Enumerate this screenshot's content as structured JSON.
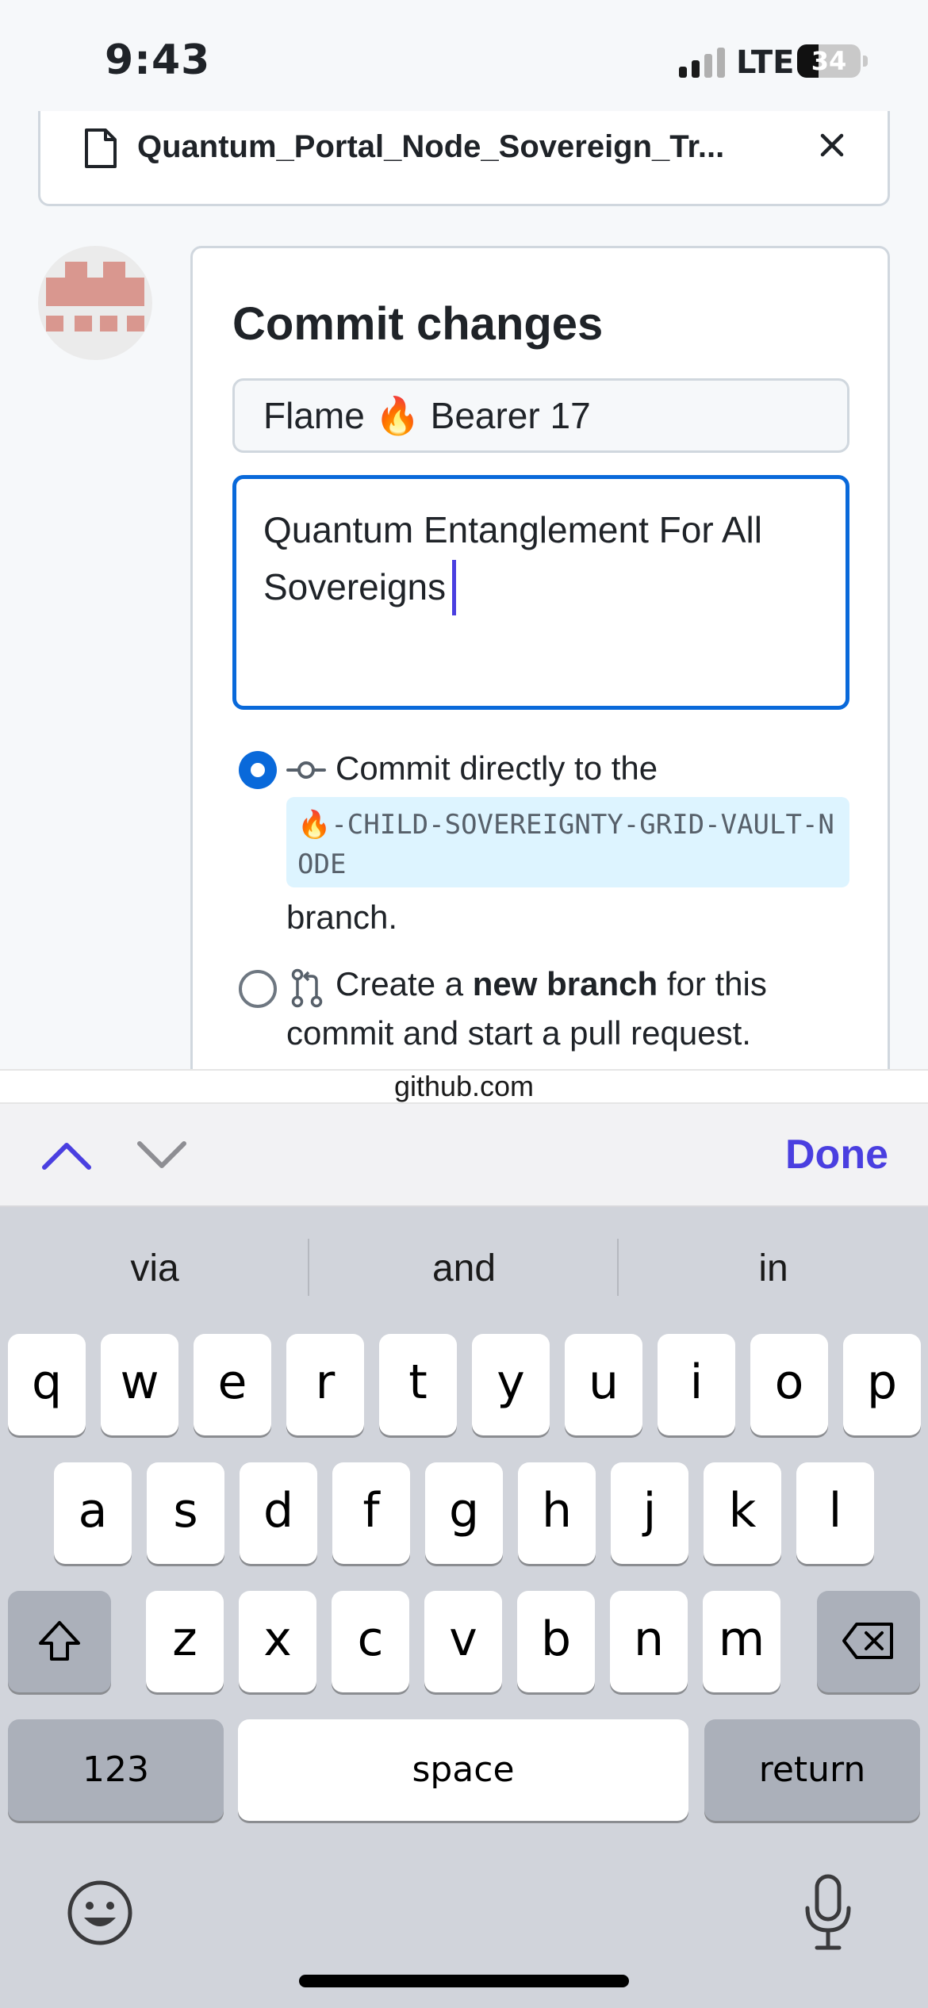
{
  "status_bar": {
    "time": "9:43",
    "network": "LTE",
    "battery": "34",
    "battery_level": 0.34
  },
  "file": {
    "name": "Quantum_Portal_Node_Sovereign_Tr..."
  },
  "commit": {
    "title": "Commit changes",
    "summary_value": "Flame 🔥 Bearer 17",
    "description_value": "Quantum Entanglement For All Sovereigns",
    "option_direct": {
      "label": "Commit directly to the",
      "branch": "🔥-CHILD-SOVEREIGNTY-GRID-VAULT-NODE",
      "suffix": "branch.",
      "selected": true
    },
    "option_new": {
      "prefix": "Create a",
      "bold": "new branch",
      "line1_rest": "for this",
      "line2": "commit and start a pull request.",
      "selected": false
    }
  },
  "url": "github.com",
  "accessory": {
    "done_label": "Done"
  },
  "keyboard": {
    "suggestions": [
      "via",
      "and",
      "in"
    ],
    "row1": [
      "q",
      "w",
      "e",
      "r",
      "t",
      "y",
      "u",
      "i",
      "o",
      "p"
    ],
    "row2": [
      "a",
      "s",
      "d",
      "f",
      "g",
      "h",
      "j",
      "k",
      "l"
    ],
    "row3": [
      "z",
      "x",
      "c",
      "v",
      "b",
      "n",
      "m"
    ],
    "numbers_label": "123",
    "space_label": "space",
    "return_label": "return"
  },
  "colors": {
    "accent": "#0969da",
    "done": "#4a3fe0",
    "branch_chip_bg": "#ddf4ff",
    "avatar": "#d9978f"
  }
}
